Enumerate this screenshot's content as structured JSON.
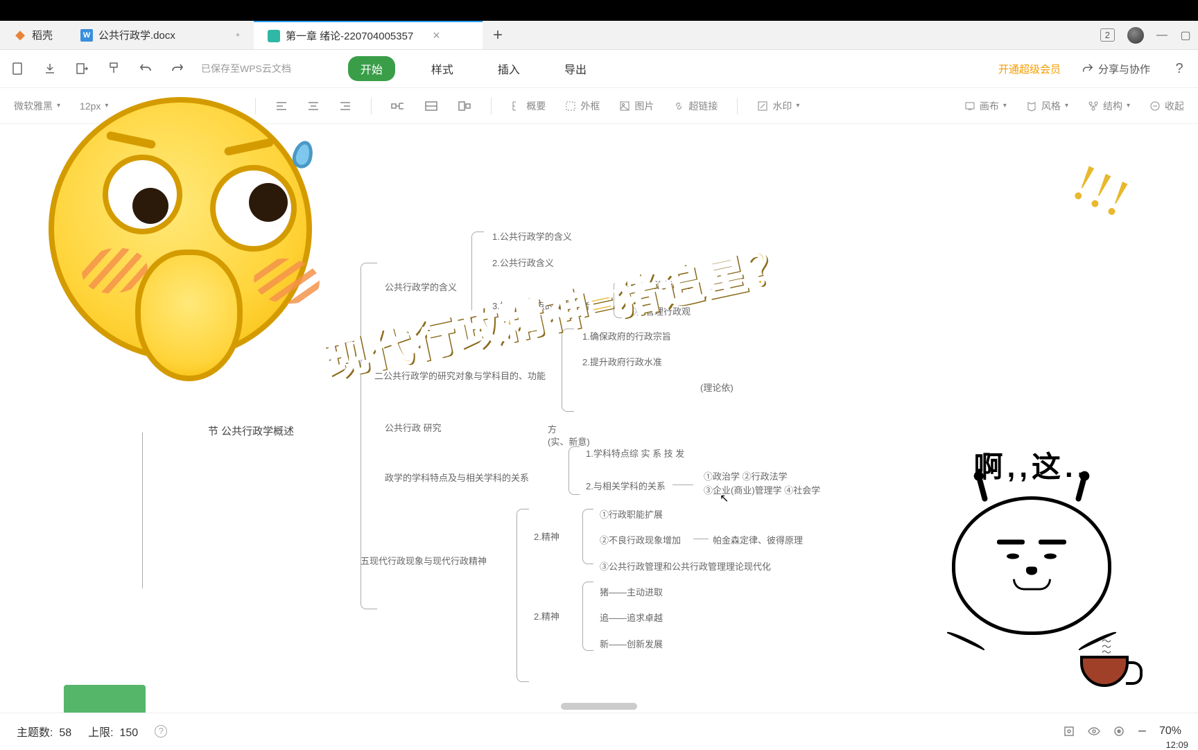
{
  "tabs": {
    "t0": {
      "label": "稻壳",
      "icon_color": "#e8833a"
    },
    "t1": {
      "label": "公共行政学.docx",
      "icon_char": "W",
      "icon_bg": "#3a8fdd"
    },
    "t2": {
      "label": "第一章 绪论-220704005357",
      "icon_bg": "#2fb8a6"
    },
    "badge": "2"
  },
  "toolbar": {
    "saved_text": "已保存至WPS云文档",
    "menu": {
      "start": "开始",
      "style": "样式",
      "insert": "插入",
      "export": "导出"
    },
    "vip": "开通超级会员",
    "share": "分享与协作"
  },
  "format": {
    "font": "微软雅黑",
    "size": "12px",
    "summary": "概要",
    "frame": "外框",
    "picture": "图片",
    "link": "超链接",
    "watermark": "水印",
    "canvas": "画布",
    "theme": "风格",
    "structure": "结构",
    "collapse": "收起"
  },
  "mindmap": {
    "root": "节 公共行政学概述",
    "n1": "公共行政学的含义",
    "n1_1": "1.公共行政学的含义",
    "n1_2": "2.公共行政含义",
    "n1_3": "3.持两种观点的行政学者",
    "n1_3a": "①持政治行政观",
    "n1_3b": "②持管理行政观",
    "n2": "二公共行政学的研究对象与学科目的、功能",
    "n2_1": "1.确保政府的行政宗旨",
    "n2_2": "2.提升政府行政水准",
    "n2_3_suffix": "(理论依)",
    "n2_4_pre": "方",
    "n2_4_suf": "(实、新意)",
    "n3": "公共行政    研究",
    "n4": "政学的学科特点及与相关学科的关系",
    "n4_1": "1.学科特点综 实 系 技 发",
    "n4_2": "2.与相关学科的关系",
    "n4_2a": "①政治学 ②行政法学",
    "n4_2b": "③企业(商业)管理学 ④社会学",
    "n5": "五现代行政现象与现代行政精神",
    "n5_1": "2.精神",
    "n5_1a": "①行政职能扩展",
    "n5_1b": "②不良行政现象增加",
    "n5_1b2": "帕金森定律、彼得原理",
    "n5_1c": "③公共行政管理和公共行政管理理论现代化",
    "n5_2": "2.精神",
    "n5_2a": "猪——主动进取",
    "n5_2b": "追——追求卓越",
    "n5_2c": "新——创新发展"
  },
  "overlay": {
    "text": "现代行政精神=猪追星？",
    "exclaim": "!!!",
    "meme_title": "啊,,这.."
  },
  "status": {
    "topics_label": "主题数:",
    "topics": "58",
    "limit_label": "上限:",
    "limit": "150",
    "zoom": "70%",
    "time": "12:09"
  }
}
